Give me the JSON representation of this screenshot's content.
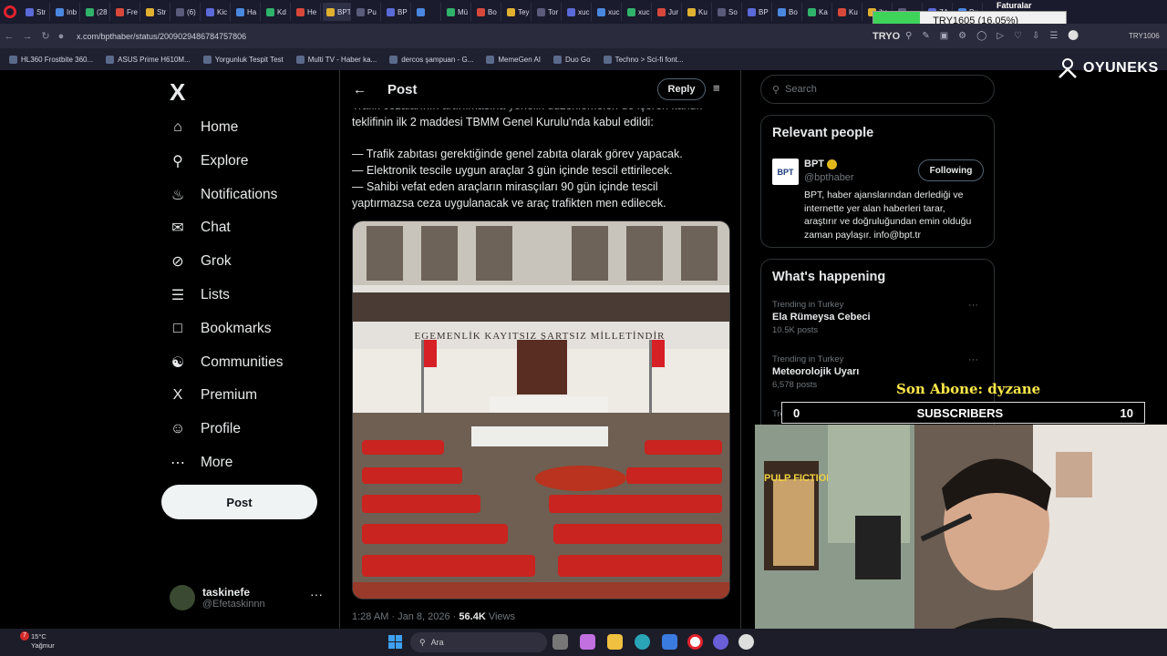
{
  "browser": {
    "tabs": [
      "Str",
      "Inb",
      "(28",
      "Fre",
      "Str",
      "(6)",
      "Kic",
      "Ha",
      "Kd",
      "He",
      "BPT o",
      "Pu",
      "BP",
      "",
      "Mü",
      "Bo",
      "Tey",
      "Tor",
      "xuc",
      "xuc",
      "xuc",
      "Jur",
      "Ku",
      "So",
      "BP",
      "Bo",
      "Ka",
      "Ku",
      "ibr",
      "",
      "ZA",
      "Pu"
    ],
    "url": "x.com/bpthaber/status/2009029486784757806",
    "bookmarks": [
      "HL360 Frostbite 360...",
      "ASUS Prime H610M...",
      "Yorgunluk Tespit Test",
      "Multi TV - Haber ka...",
      "dercos şampuan - G...",
      "MemeGen AI",
      "Duo Go",
      "Techno > Sci-fi font..."
    ]
  },
  "overlay": {
    "ticker_label": "TRY1605 (16.05%)",
    "faturalar": "Faturalar",
    "tryo": "TRYO",
    "tryo_right": "TRY1006",
    "logo": "OYUNEKS",
    "son_abone": "Son Abone: dyzane",
    "subs_left": "0",
    "subs_label": "SUBSCRIBERS",
    "subs_right": "10",
    "poster_text": "PULP FICTION",
    "ticker_fill": 0.24
  },
  "sidebar": {
    "items": [
      {
        "label": "Home",
        "icon": "home-icon"
      },
      {
        "label": "Explore",
        "icon": "search-icon"
      },
      {
        "label": "Notifications",
        "icon": "bell-icon"
      },
      {
        "label": "Chat",
        "icon": "mail-icon"
      },
      {
        "label": "Grok",
        "icon": "grok-icon"
      },
      {
        "label": "Lists",
        "icon": "list-icon"
      },
      {
        "label": "Bookmarks",
        "icon": "bookmark-icon"
      },
      {
        "label": "Communities",
        "icon": "communities-icon"
      },
      {
        "label": "Premium",
        "icon": "x-icon"
      },
      {
        "label": "Profile",
        "icon": "person-icon"
      },
      {
        "label": "More",
        "icon": "more-icon"
      }
    ],
    "post_label": "Post",
    "account_name": "taskinefe",
    "account_handle": "@Efetaskinnn"
  },
  "post": {
    "header_title": "Post",
    "reply_label": "Reply",
    "text_line0": "Trafik cezalarının artırılmasına yönelik düzenlemeleri de içeren kanun",
    "text_line1": "teklifinin ilk 2 maddesi TBMM Genel Kurulu'nda kabul edildi:",
    "text_line2": "— Trafik zabıtası gerektiğinde genel zabıta olarak görev yapacak.",
    "text_line3": "— Elektronik tescile uygun araçlar 3 gün içinde tescil ettirilecek.",
    "text_line4": "— Sahibi vefat eden araçların mirasçıları 90 gün içinde tescil",
    "text_line5": "yaptırmazsa ceza uygulanacak ve araç trafikten men edilecek.",
    "banner_text": "EGEMENLİK KAYITSIZ ŞARTSIZ MİLLETİNDİR",
    "time": "1:28 AM · Jan 8, 2026 ·",
    "views_count": "56.4K",
    "views_label": "Views"
  },
  "right": {
    "search_placeholder": "Search",
    "relevant_title": "Relevant people",
    "person_name": "BPT",
    "person_handle": "@bpthaber",
    "avatar_text": "BPT",
    "following_label": "Following",
    "bio1": "BPT, haber ajanslarından derlediği ve",
    "bio2": "internette yer alan haberleri tarar,",
    "bio3": "araştırır ve doğruluğundan emin olduğu",
    "bio4": "zaman paylaşır. info@bpt.tr",
    "happening_title": "What's happening",
    "trends": [
      {
        "context": "Trending in Turkey",
        "name": "Ela Rümeysa Cebeci",
        "posts": "10.5K posts"
      },
      {
        "context": "Trending in Turkey",
        "name": "Meteorolojik Uyarı",
        "posts": "6,578 posts"
      },
      {
        "context": "Trending in Turkey",
        "name": "",
        "posts": ""
      }
    ]
  },
  "taskbar": {
    "temp": "15°C",
    "weather": "Yağmur",
    "search_label": "Ara",
    "badge": "7"
  }
}
